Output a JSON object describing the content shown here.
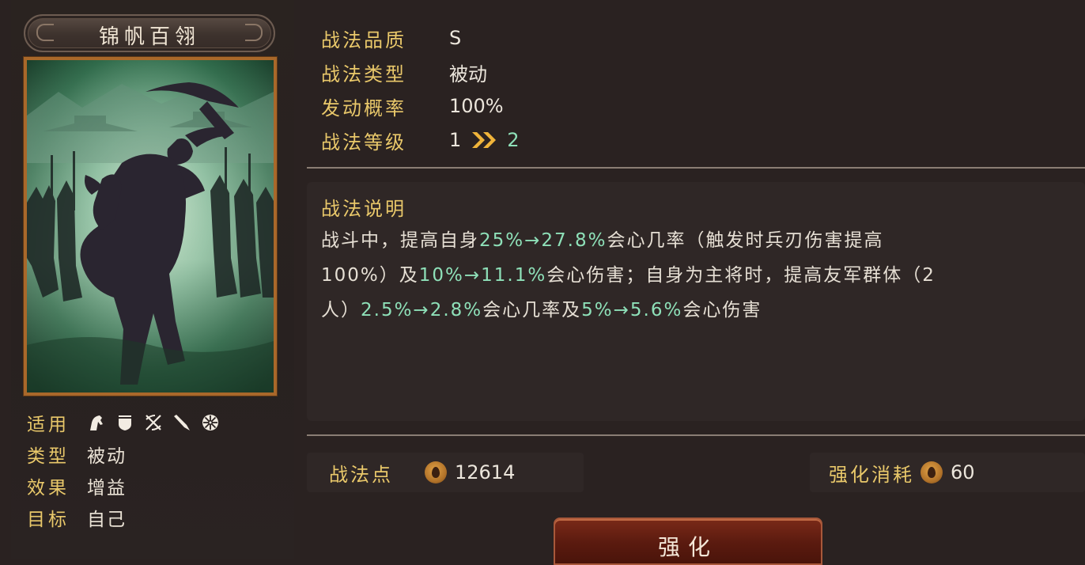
{
  "skill": {
    "name": "锦帆百翎",
    "attributes": [
      {
        "label": "适用",
        "value": "",
        "icons": [
          "cavalry-icon",
          "shield-icon",
          "bow-icon",
          "spear-icon",
          "wheel-icon"
        ]
      },
      {
        "label": "类型",
        "value": "被动"
      },
      {
        "label": "效果",
        "value": "增益"
      },
      {
        "label": "目标",
        "value": "自己"
      }
    ]
  },
  "info": {
    "quality": {
      "label": "战法品质",
      "value": "S"
    },
    "type": {
      "label": "战法类型",
      "value": "被动"
    },
    "rate": {
      "label": "发动概率",
      "value": "100%"
    },
    "level": {
      "label": "战法等级",
      "current": "1",
      "next": "2"
    }
  },
  "description": {
    "title": "战法说明",
    "segments": [
      {
        "text": "战斗中，提高自身",
        "hl": false
      },
      {
        "text": "25%→27.8%",
        "hl": true
      },
      {
        "text": "会心几率（触发时兵刃伤害提高",
        "hl": false
      },
      {
        "text": "100%）及",
        "hl": false
      },
      {
        "text": "10%→11.1%",
        "hl": true
      },
      {
        "text": "会心伤害；自身为主将时，提高友军群体（2",
        "hl": false
      },
      {
        "text": "人）",
        "hl": false
      },
      {
        "text": "2.5%→2.8%",
        "hl": true
      },
      {
        "text": "会心几率及",
        "hl": false
      },
      {
        "text": "5%→5.6%",
        "hl": true
      },
      {
        "text": "会心伤害",
        "hl": false
      }
    ]
  },
  "points": {
    "label": "战法点",
    "value": "12614"
  },
  "cost": {
    "label": "强化消耗",
    "value": "60"
  },
  "button": {
    "label": "强化"
  },
  "colors": {
    "gold": "#e9c86a",
    "highlight": "#8ee0b8",
    "frame": "#a9682a",
    "button": "#5a1a0f"
  }
}
